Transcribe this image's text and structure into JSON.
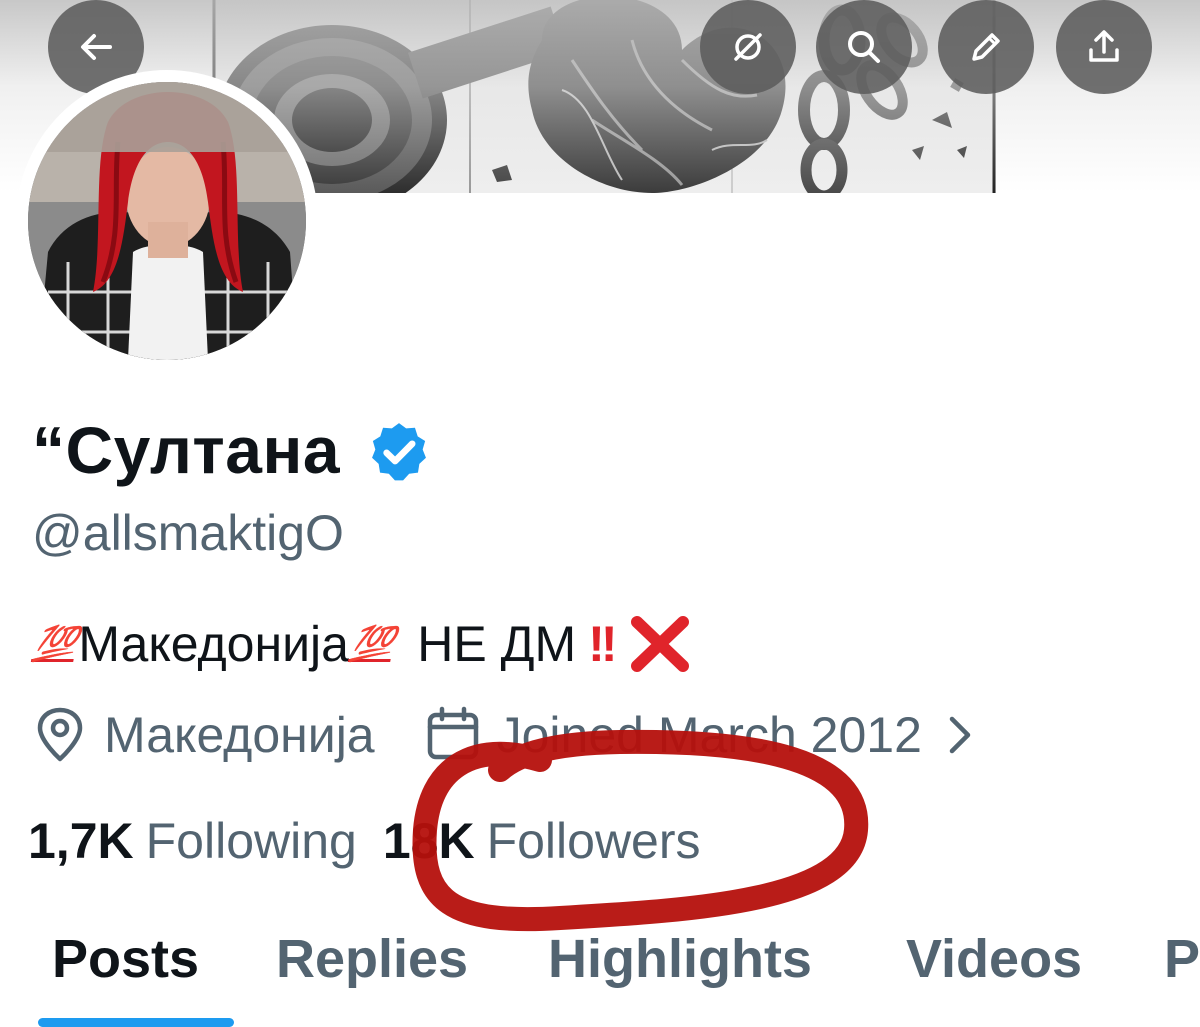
{
  "profile": {
    "display_name": "“Султана",
    "handle": "@allsmaktigO",
    "verified_icon": "verified-badge-icon",
    "bio": {
      "emoji1": "💯",
      "text1": "Македонија",
      "emoji2": "💯",
      "text2": "НЕ ДМ",
      "exclaim": "!!",
      "cross_icon": "red-x-icon"
    },
    "location": "Македонија",
    "joined": "Joined March 2012",
    "following_count": "1,7K",
    "following_label": "Following",
    "followers_count": "18K",
    "followers_label": "Followers"
  },
  "top_bar": {
    "buttons": [
      "back-arrow-icon",
      "grok-icon",
      "search-icon",
      "pencil-icon",
      "share-icon"
    ]
  },
  "tabs": [
    {
      "label": "Posts",
      "active": true
    },
    {
      "label": "Replies",
      "active": false
    },
    {
      "label": "Highlights",
      "active": false
    },
    {
      "label": "Videos",
      "active": false
    },
    {
      "label": "P",
      "active": false
    }
  ],
  "colors": {
    "accent": "#1d9bf0",
    "secondary_text": "#536471",
    "primary_text": "#0f1419",
    "annotation_red": "#b5100c",
    "button_bg": "#5c5c5c"
  }
}
